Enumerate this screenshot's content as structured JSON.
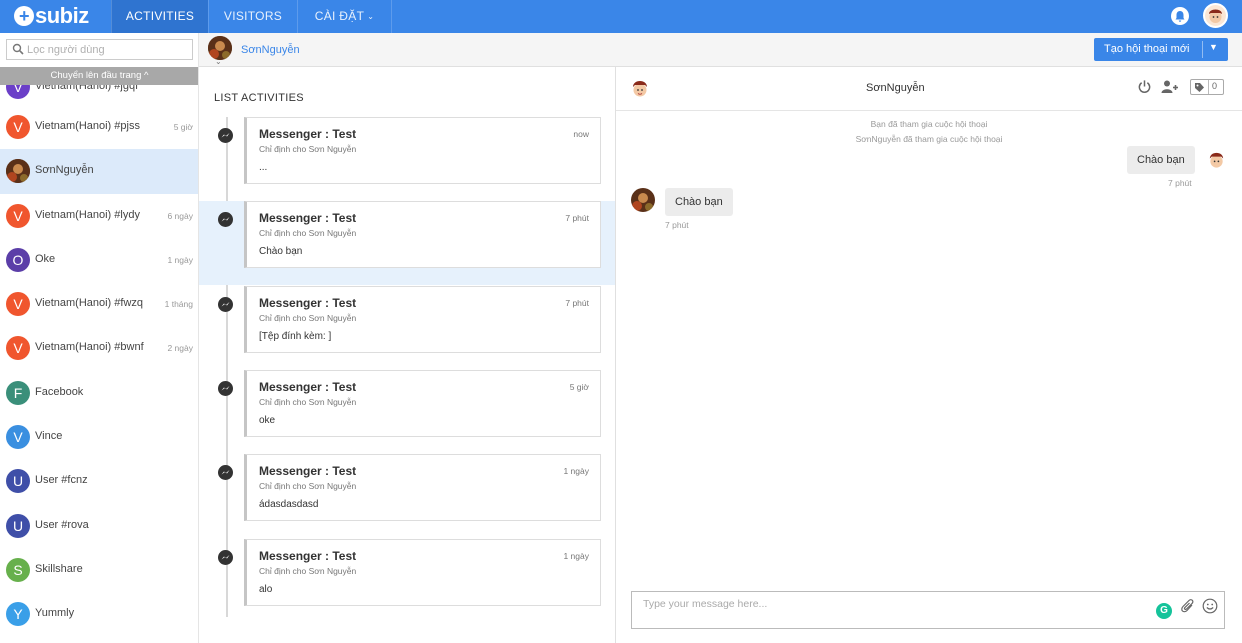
{
  "nav": {
    "logo": "subiz",
    "tabs": [
      {
        "label": "ACTIVITIES"
      },
      {
        "label": "VISITORS"
      },
      {
        "label": "CÀI ĐẶT"
      }
    ]
  },
  "sidebar": {
    "search_placeholder": "Lọc người dùng",
    "scroll_top": "Chuyển lên đầu trang ^",
    "contacts": [
      {
        "initial": "V",
        "name": "Vietnam(Hanoi) #jgqf",
        "time": "",
        "color": "#6b3fc8"
      },
      {
        "initial": "V",
        "name": "Vietnam(Hanoi) #pjss",
        "time": "5 giờ",
        "color": "#f0562e"
      },
      {
        "initial": "",
        "name": "SơnNguyễn",
        "time": "",
        "color": "#6a3b1f"
      },
      {
        "initial": "V",
        "name": "Vietnam(Hanoi) #lydy",
        "time": "6 ngày",
        "color": "#f0562e"
      },
      {
        "initial": "O",
        "name": "Oke",
        "time": "1 ngày",
        "color": "#5b3ea8"
      },
      {
        "initial": "V",
        "name": "Vietnam(Hanoi) #fwzq",
        "time": "1 tháng",
        "color": "#f0562e"
      },
      {
        "initial": "V",
        "name": "Vietnam(Hanoi) #bwnf",
        "time": "2 ngày",
        "color": "#f0562e"
      },
      {
        "initial": "F",
        "name": "Facebook",
        "time": "",
        "color": "#3a8f7a"
      },
      {
        "initial": "V",
        "name": "Vince",
        "time": "",
        "color": "#3a8fe0"
      },
      {
        "initial": "U",
        "name": "User #fcnz",
        "time": "",
        "color": "#3f4fa8"
      },
      {
        "initial": "U",
        "name": "User #rova",
        "time": "",
        "color": "#3f4fa8"
      },
      {
        "initial": "S",
        "name": "Skillshare",
        "time": "",
        "color": "#67b04c"
      },
      {
        "initial": "Y",
        "name": "Yummly",
        "time": "",
        "color": "#3a9fe8"
      }
    ]
  },
  "header": {
    "contact_name": "SơnNguyễn",
    "new_conversation": "Tạo hội thoại mới"
  },
  "activities": {
    "title": "LIST ACTIVITIES",
    "items": [
      {
        "title": "Messenger : Test",
        "subtitle": "Chỉ định cho Sơn Nguyễn",
        "body": "...",
        "time": "now"
      },
      {
        "title": "Messenger : Test",
        "subtitle": "Chỉ định cho Sơn Nguyễn",
        "body": "Chào bạn",
        "time": "7 phút"
      },
      {
        "title": "Messenger : Test",
        "subtitle": "Chỉ định cho Sơn Nguyễn",
        "body": "[Tệp đính kèm: ]",
        "time": "7 phút"
      },
      {
        "title": "Messenger : Test",
        "subtitle": "Chỉ định cho Sơn Nguyễn",
        "body": "oke",
        "time": "5 giờ"
      },
      {
        "title": "Messenger : Test",
        "subtitle": "Chỉ định cho Sơn Nguyễn",
        "body": "ádasdasdasd",
        "time": "1 ngày"
      },
      {
        "title": "Messenger : Test",
        "subtitle": "Chỉ định cho Sơn Nguyễn",
        "body": "alo",
        "time": "1 ngày"
      }
    ]
  },
  "chat": {
    "name": "SơnNguyễn",
    "tag_count": "0",
    "system": [
      "Bạn đã tham gia cuộc hội thoại",
      "SơnNguyễn đã tham gia cuộc hội thoại"
    ],
    "messages": [
      {
        "text": "Chào bạn",
        "time": "7 phút",
        "side": "right"
      },
      {
        "text": "Chào bạn",
        "time": "7 phút",
        "side": "left"
      }
    ],
    "composer_placeholder": "Type your message here...",
    "grammarly": "G"
  }
}
